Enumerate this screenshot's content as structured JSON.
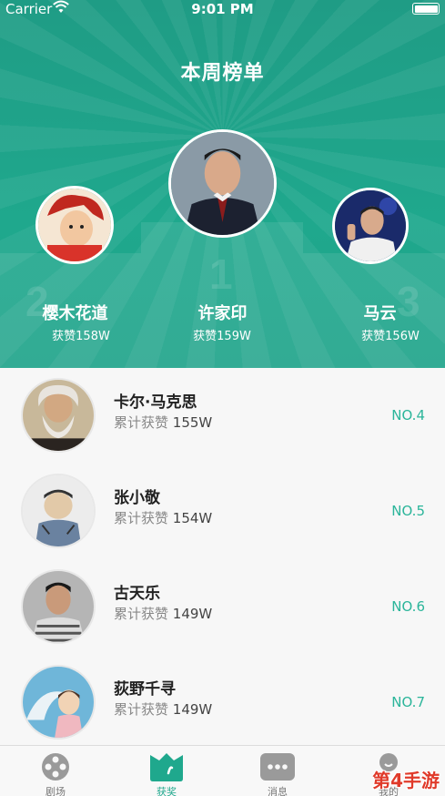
{
  "status": {
    "carrier": "Carrier",
    "time": "9:01 PM"
  },
  "header": {
    "title": "本周榜单"
  },
  "podium": [
    {
      "rank": "2",
      "name": "樱木花道",
      "likes": "获赞158W"
    },
    {
      "rank": "1",
      "name": "许家印",
      "likes": "获赞159W"
    },
    {
      "rank": "3",
      "name": "马云",
      "likes": "获赞156W"
    }
  ],
  "list": [
    {
      "name": "卡尔·马克思",
      "likes_label": "累计获赞",
      "likes_value": "155W",
      "rank": "NO.4"
    },
    {
      "name": "张小敬",
      "likes_label": "累计获赞",
      "likes_value": "154W",
      "rank": "NO.5"
    },
    {
      "name": "古天乐",
      "likes_label": "累计获赞",
      "likes_value": "149W",
      "rank": "NO.6"
    },
    {
      "name": "荻野千寻",
      "likes_label": "累计获赞",
      "likes_value": "149W",
      "rank": "NO.7"
    }
  ],
  "tabs": [
    {
      "label": "剧场",
      "icon": "film-reel-icon"
    },
    {
      "label": "获奖",
      "icon": "trophy-icon"
    },
    {
      "label": "消息",
      "icon": "chat-bubble-icon"
    },
    {
      "label": "我的",
      "icon": "profile-icon"
    }
  ],
  "watermark": "第4手游",
  "colors": {
    "accent": "#1fa88d",
    "rank_text": "#2bb59a"
  }
}
